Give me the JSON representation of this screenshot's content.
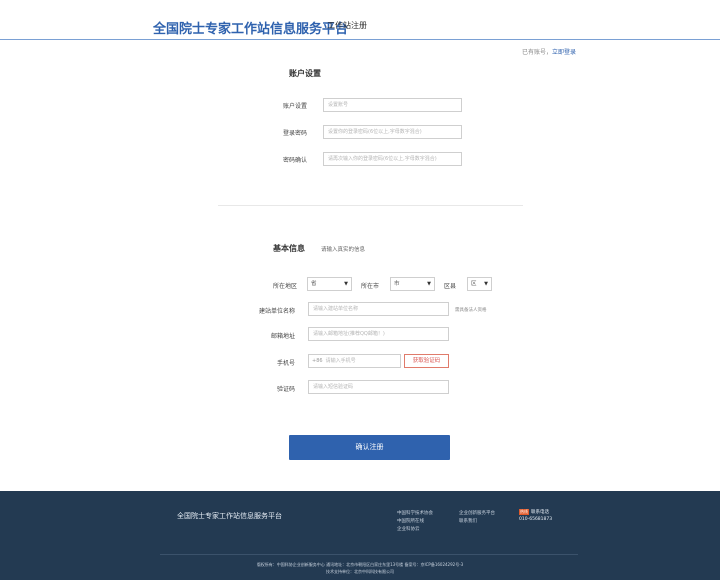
{
  "header": {
    "title": "全国院士专家工作站信息服务平台",
    "subtitle": "工作站注册"
  },
  "login_hint": {
    "text": "已有账号，",
    "link": "立即登录"
  },
  "account": {
    "section_title": "账户设置",
    "fields": [
      {
        "label": "账户设置",
        "placeholder": "设置账号"
      },
      {
        "label": "登录密码",
        "placeholder": "设置你的登录密码(6位以上,字母数字混合)"
      },
      {
        "label": "密码确认",
        "placeholder": "请再次输入你的登录密码(6位以上,字母数字混合)"
      }
    ]
  },
  "basic": {
    "section_title": "基本信息",
    "hint": "请输入真实的信息",
    "region": {
      "label": "所在地区",
      "province": "省",
      "city_label": "所在市",
      "city": "市",
      "county_label": "区县",
      "county": "区"
    },
    "unit": {
      "label": "建站单位名称",
      "placeholder": "请输入建站单位名称",
      "note": "需具备法人资格"
    },
    "email": {
      "label": "邮箱地址",
      "placeholder": "请输入邮箱地址(推荐QQ邮箱！)"
    },
    "phone": {
      "label": "手机号",
      "prefix": "+86",
      "placeholder": "请输入手机号",
      "code_button": "获取验证码"
    },
    "verify": {
      "label": "验证码",
      "placeholder": "请输入短信验证码"
    }
  },
  "submit_label": "确认注册",
  "footer": {
    "brand": "全国院士专家工作站信息服务平台",
    "col1": [
      "中国科学技术协会",
      "中国院所在线",
      "企业科协云"
    ],
    "col2": [
      "企业创新服务平台",
      "联系我们"
    ],
    "contact_badge": "热线",
    "contact_title": "联系电话",
    "contact_phone": "010-65681873",
    "copyright": "版权所有：中国科协企业创新服务中心 通讯地址：北京市朝阳区白家庄东里13号楼 备案号：京ICP备16024292号-3",
    "tech_support": "技术支持单位：北京中科科技有限公司"
  },
  "colors": {
    "brand_blue": "#2f62ae",
    "footer_bg": "#233a52",
    "code_red": "#d9534f"
  }
}
